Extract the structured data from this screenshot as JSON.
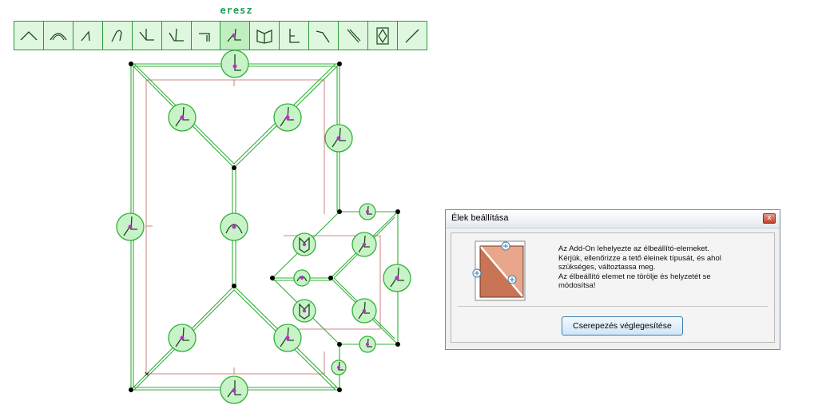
{
  "toolbar": {
    "title": "eresz",
    "buttons": [
      {
        "icon": "ridge-icon"
      },
      {
        "icon": "rounded-ridge-icon"
      },
      {
        "icon": "slope-left-icon"
      },
      {
        "icon": "slope-hook-icon"
      },
      {
        "icon": "valley-icon"
      },
      {
        "icon": "hip-icon"
      },
      {
        "icon": "gable-end-icon"
      },
      {
        "icon": "eave-icon",
        "selected": true
      },
      {
        "icon": "book-icon"
      },
      {
        "icon": "wall-junction-icon"
      },
      {
        "icon": "diagonal-bend-icon"
      },
      {
        "icon": "diagonal-slash-icon"
      },
      {
        "icon": "diamond-icon"
      },
      {
        "icon": "line-icon"
      }
    ]
  },
  "colors": {
    "plan_line": "#2fb036",
    "marker": "#c02ad0",
    "dimension_line": "#c06060",
    "toolbar_bg": "#dff6df"
  },
  "dialog": {
    "title": "Élek beállítása",
    "close_label": "x",
    "message_lines": [
      "Az Add-On lehelyezte az élbeállító-elemeket.",
      "Kérjük, ellenőrizze a tető éleinek típusát, és ahol",
      "szükséges, változtassa meg.",
      "Az élbeállító elemet ne törölje és helyzetét se",
      "módosítsa!"
    ],
    "button_label": "Cserepezés véglegesítése",
    "image_icon": "roof-tile-edge-icon"
  }
}
